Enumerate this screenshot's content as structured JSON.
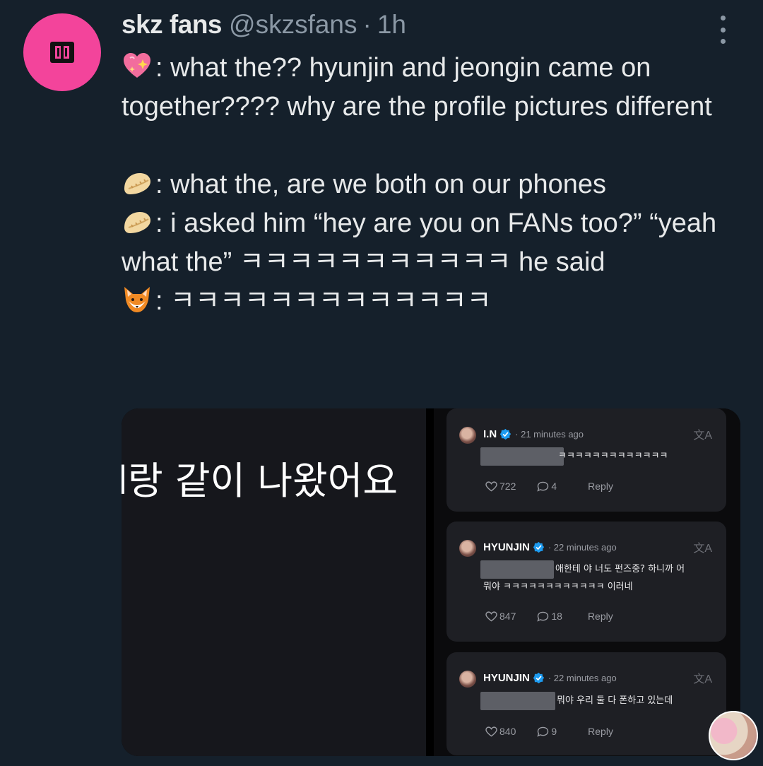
{
  "tweet": {
    "display_name": "skz fans",
    "handle": "@skzsfans",
    "separator": "·",
    "time": "1h",
    "avatar_color": "#f3449b",
    "paragraphs": [
      {
        "emoji": "sparkling-heart",
        "text": ": what the?? hyunjin and jeongin came on together???? why are the profile pictures different"
      },
      {
        "emoji": "dumpling",
        "text": ": what the, are we both on our phones"
      },
      {
        "emoji": "dumpling",
        "text": ": i asked him “hey are you on FANs too?” “yeah what the” ㅋㅋㅋㅋㅋㅋㅋㅋㅋㅋㅋ he said"
      },
      {
        "emoji": "fox",
        "text": ": ㅋㅋㅋㅋㅋㅋㅋㅋㅋㅋㅋㅋㅋ"
      }
    ]
  },
  "media": {
    "left_image_text": "l랑 같이 나왔어요",
    "comments": [
      {
        "user": "I.N",
        "time": "· 21 minutes ago",
        "body_lines": [
          "ㅋㅋㅋㅋㅋㅋㅋㅋㅋㅋㅋㅋㅋ"
        ],
        "likes": "722",
        "replies": "4",
        "reply_label": "Reply"
      },
      {
        "user": "HYUNJIN",
        "time": "· 22 minutes ago",
        "body_lines": [
          "애한테 야 너도 펀즈중? 하니까 어",
          "뭐야 ㅋㅋㅋㅋㅋㅋㅋㅋㅋㅋㅋㅋ 이러네"
        ],
        "likes": "847",
        "replies": "18",
        "reply_label": "Reply"
      },
      {
        "user": "HYUNJIN",
        "time": "· 22 minutes ago",
        "body_lines": [
          "뭐야 우리 둘 다 폰하고 있는데"
        ],
        "likes": "840",
        "replies": "9",
        "reply_label": "Reply"
      }
    ]
  },
  "icons": {
    "more": "more-vertical-icon",
    "translate": "translate-icon",
    "verified": "verified-badge-icon",
    "like": "heart-icon",
    "comment": "comment-bubble-icon"
  },
  "colors": {
    "background": "#15202b",
    "verified": "#1d9bf0",
    "muted": "#8b98a5"
  }
}
